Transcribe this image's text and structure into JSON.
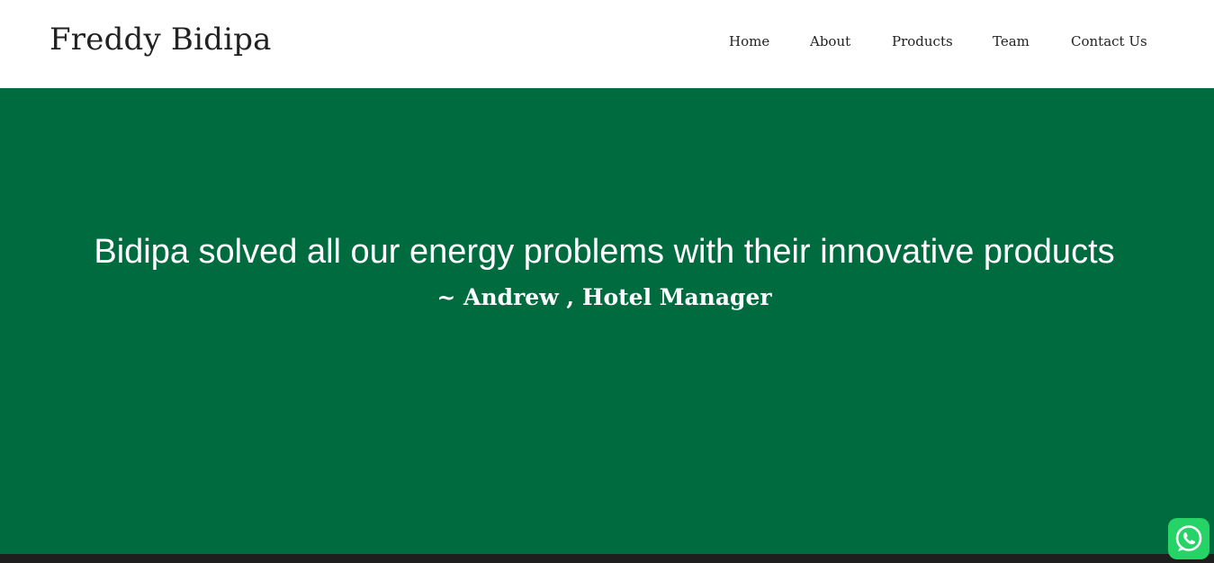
{
  "header": {
    "brand": "Freddy Bidipa",
    "nav": [
      {
        "label": "Home"
      },
      {
        "label": "About"
      },
      {
        "label": "Products"
      },
      {
        "label": "Team"
      },
      {
        "label": "Contact Us"
      }
    ]
  },
  "hero": {
    "quote": "Bidipa solved all our energy problems with their innovative products",
    "author": "~ Andrew , Hotel Manager"
  },
  "whatsapp": {
    "icon": "whatsapp-icon"
  },
  "colors": {
    "hero_bg": "#006b3f",
    "footer_bg": "#1e1e1e",
    "whatsapp_bg": "#25d366",
    "text_dark": "#222222"
  }
}
